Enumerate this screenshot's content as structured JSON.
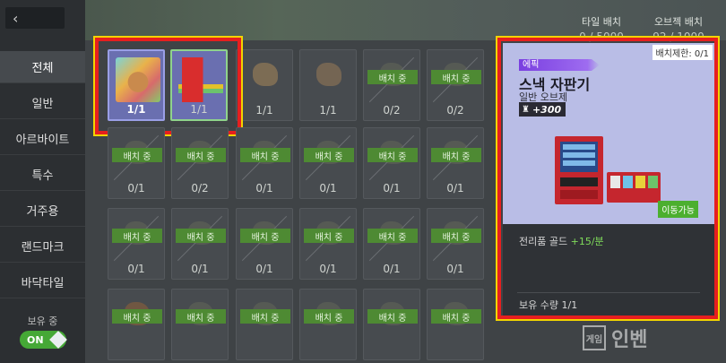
{
  "sidebar": {
    "back_icon": "‹",
    "items": [
      {
        "label": "전체"
      },
      {
        "label": "일반"
      },
      {
        "label": "아르바이트"
      },
      {
        "label": "특수"
      },
      {
        "label": "거주용"
      },
      {
        "label": "랜드마크"
      },
      {
        "label": "바닥타일"
      }
    ],
    "toggle_label": "보유 중",
    "toggle_state": "ON"
  },
  "header": {
    "tile_label": "타일 배치",
    "tile_value": "0 / 5000",
    "object_label": "오브젝 배치",
    "object_value": "92 / 1000"
  },
  "grid": {
    "placed_label": "배치 중",
    "row1": [
      "1/1",
      "1/1",
      "1/1",
      "1/1",
      "0/2",
      "0/2"
    ],
    "row2": [
      "0/1",
      "0/2",
      "0/1",
      "0/1",
      "0/1",
      "0/1"
    ],
    "row3": [
      "0/1",
      "0/1",
      "0/1",
      "0/1",
      "0/1",
      "0/1"
    ]
  },
  "detail": {
    "limit": "배치제한: 0/1",
    "rarity": "에픽",
    "name": "스낵 자판기",
    "type": "일반 오브제",
    "score": "+300",
    "movable": "이동가능",
    "production_label": "전리품 골드",
    "production_value": "+15/분",
    "owned_label": "보유 수량",
    "owned_value": "1/1"
  },
  "watermark": {
    "logo": "게임",
    "text": "인벤"
  }
}
